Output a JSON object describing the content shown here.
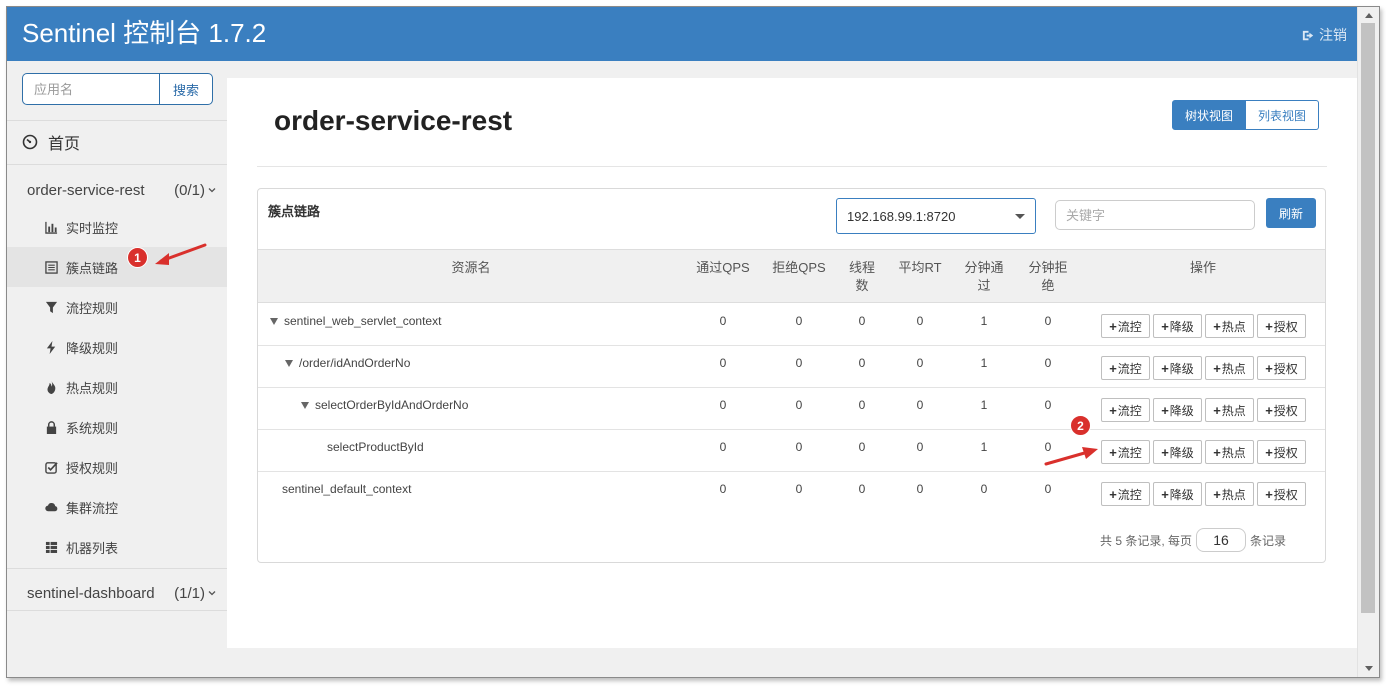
{
  "header": {
    "brand": "Sentinel 控制台 1.7.2",
    "logout_label": "注销"
  },
  "sidebar": {
    "search_placeholder": "应用名",
    "search_button": "搜索",
    "home_label": "首页",
    "apps": [
      {
        "name": "order-service-rest",
        "count": "(0/1)"
      },
      {
        "name": "sentinel-dashboard",
        "count": "(1/1)"
      }
    ],
    "menu": [
      {
        "label": "实时监控",
        "icon": "bar-chart-icon"
      },
      {
        "label": "簇点链路",
        "icon": "list-icon",
        "active": true
      },
      {
        "label": "流控规则",
        "icon": "filter-icon"
      },
      {
        "label": "降级规则",
        "icon": "flash-icon"
      },
      {
        "label": "热点规则",
        "icon": "fire-icon"
      },
      {
        "label": "系统规则",
        "icon": "lock-icon"
      },
      {
        "label": "授权规则",
        "icon": "check-square-icon"
      },
      {
        "label": "集群流控",
        "icon": "cloud-icon"
      },
      {
        "label": "机器列表",
        "icon": "th-list-icon"
      }
    ]
  },
  "main": {
    "title": "order-service-rest",
    "view_tree": "树状视图",
    "view_list": "列表视图",
    "panel_title": "簇点链路",
    "machine_select": "192.168.99.1:8720",
    "keyword_placeholder": "关键字",
    "refresh_button": "刷新",
    "columns": {
      "resource": "资源名",
      "pass_qps": "通过QPS",
      "block_qps": "拒绝QPS",
      "threads_1": "线程",
      "threads_2": "数",
      "avg_rt": "平均RT",
      "min_pass_1": "分钟通",
      "min_pass_2": "过",
      "min_block_1": "分钟拒",
      "min_block_2": "绝",
      "ops": "操作"
    },
    "rows": [
      {
        "name": "sentinel_web_servlet_context",
        "pass_qps": "0",
        "block_qps": "0",
        "threads": "0",
        "avg_rt": "0",
        "min_pass": "1",
        "min_block": "0"
      },
      {
        "name": "/order/idAndOrderNo",
        "pass_qps": "0",
        "block_qps": "0",
        "threads": "0",
        "avg_rt": "0",
        "min_pass": "1",
        "min_block": "0"
      },
      {
        "name": "selectOrderByIdAndOrderNo",
        "pass_qps": "0",
        "block_qps": "0",
        "threads": "0",
        "avg_rt": "0",
        "min_pass": "1",
        "min_block": "0"
      },
      {
        "name": "selectProductById",
        "pass_qps": "0",
        "block_qps": "0",
        "threads": "0",
        "avg_rt": "0",
        "min_pass": "1",
        "min_block": "0"
      },
      {
        "name": "sentinel_default_context",
        "pass_qps": "0",
        "block_qps": "0",
        "threads": "0",
        "avg_rt": "0",
        "min_pass": "0",
        "min_block": "0"
      }
    ],
    "op_buttons": {
      "flow": "流控",
      "degrade": "降级",
      "hotspot": "热点",
      "auth": "授权"
    },
    "pager": {
      "prefix": "共 5 条记录, 每页",
      "page_size": "16",
      "suffix": "条记录"
    }
  },
  "annotations": {
    "badge1": "1",
    "badge2": "2",
    "accent_color": "#d9302c"
  }
}
